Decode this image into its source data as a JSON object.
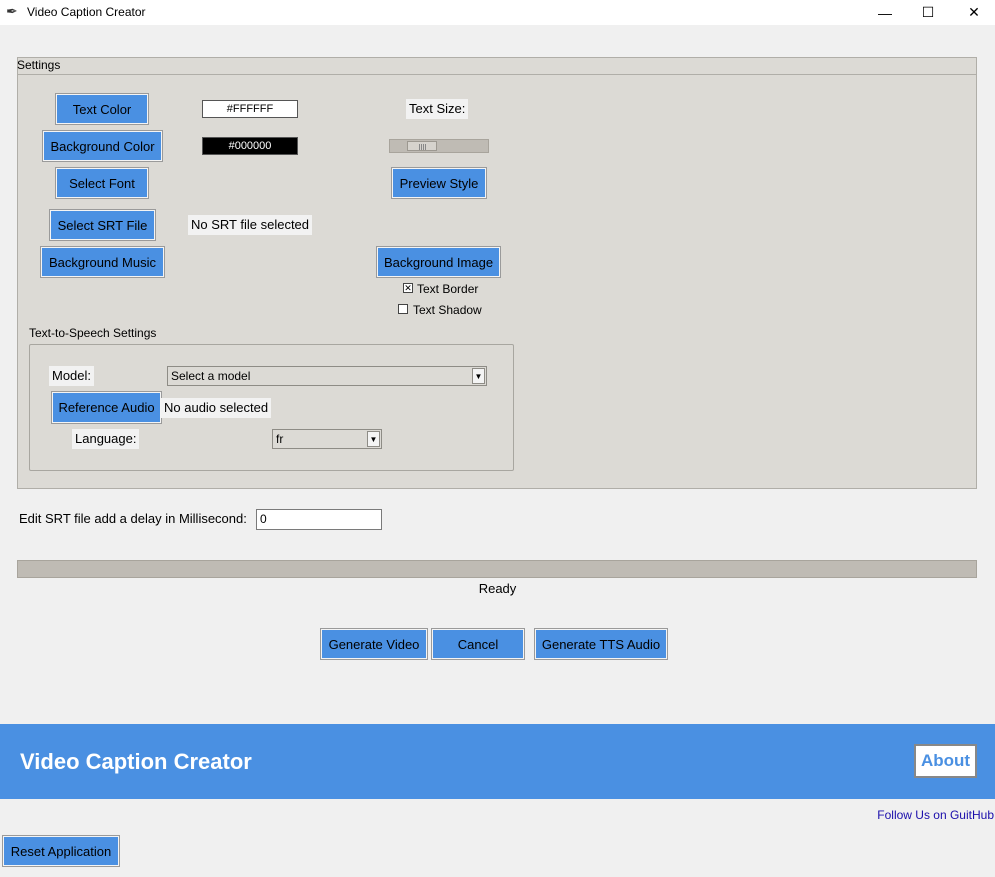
{
  "window": {
    "title": "Video Caption Creator",
    "minimize": "—",
    "maximize": "☐",
    "close": "✕"
  },
  "settings": {
    "section_label": "Settings",
    "text_color_button": "Text Color",
    "text_color_value": "#FFFFFF",
    "background_color_button": "Background Color",
    "background_color_value": "#000000",
    "text_size_label": "Text Size:",
    "text_size_fraction": 0.25,
    "select_font_button": "Select Font",
    "preview_style_button": "Preview Style",
    "select_srt_button": "Select SRT File",
    "srt_status": "No SRT file selected",
    "background_music_button": "Background Music",
    "background_image_button": "Background Image",
    "text_border_label": "Text Border",
    "text_border_checked": true,
    "text_shadow_label": "Text Shadow",
    "text_shadow_checked": false
  },
  "tts": {
    "section_label": "Text-to-Speech Settings",
    "model_label": "Model:",
    "model_value": "Select a model",
    "reference_audio_button": "Reference Audio",
    "audio_status": "No audio selected",
    "language_label": "Language:",
    "language_value": "fr"
  },
  "delay": {
    "label": "Edit SRT file add a delay in Millisecond:",
    "value": "0"
  },
  "progress": {
    "fraction": 0,
    "status": "Ready"
  },
  "actions": {
    "generate_video": "Generate Video",
    "cancel": "Cancel",
    "generate_tts": "Generate TTS Audio"
  },
  "banner": {
    "title": "Video Caption Creator",
    "about": "About"
  },
  "footer": {
    "github_link": "Follow Us on GuitHub",
    "reset_button": "Reset Application"
  },
  "colors": {
    "accent": "#4a90e2",
    "frame_bg": "#dcdad5",
    "window_bg": "#f0f0f0"
  },
  "icons": {
    "app_icon": "feather-icon",
    "dropdown": "chevron-down-icon"
  }
}
